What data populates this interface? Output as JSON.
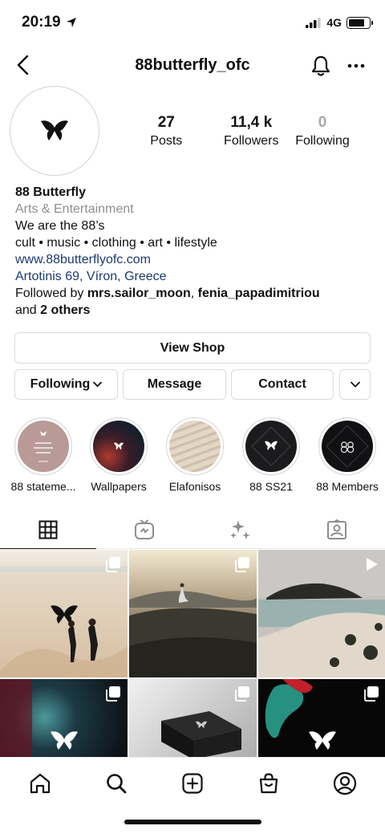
{
  "status_bar": {
    "time": "20:19",
    "network": "4G",
    "battery_level": 0.8
  },
  "nav": {
    "username": "88butterfly_ofc",
    "back_icon": "chevron-left-icon",
    "bell_icon": "bell-icon",
    "more_icon": "more-horizontal-icon"
  },
  "stats": [
    {
      "value": "27",
      "label": "Posts"
    },
    {
      "value": "11,4 k",
      "label": "Followers"
    },
    {
      "value": "0",
      "label": "Following"
    }
  ],
  "bio": {
    "name": "88 Butterfly",
    "category": "Arts & Entertainment",
    "line1": "We are the 88’s",
    "line2": "cult • music • clothing • art • lifestyle",
    "website": "www.88butterflyofc.com",
    "address": "Artotinis 69, Víron, Greece",
    "followed_by_prefix": "Followed by ",
    "followed_user1": "mrs.sailor_moon",
    "followed_sep": ", ",
    "followed_user2": "fenia_papadimitriou",
    "followed_and": "and ",
    "followed_others": "2 others"
  },
  "buttons": {
    "view_shop": "View Shop",
    "following": "Following",
    "message": "Message",
    "contact": "Contact"
  },
  "highlights": [
    {
      "label": "88 stateme...",
      "bg": "#b99a97"
    },
    {
      "label": "Wallpapers",
      "bg": "#1d2733"
    },
    {
      "label": "Elafonisos",
      "bg": "#d8cbb9"
    },
    {
      "label": "88 SS21",
      "bg": "#1b1b1e"
    },
    {
      "label": "88 Members",
      "bg": "#111114"
    }
  ],
  "tabs": [
    "grid-icon",
    "igtv-icon",
    "reels-sparkle-icon",
    "tagged-icon"
  ],
  "bottom_nav": [
    "home-icon",
    "search-icon",
    "new-post-icon",
    "shop-bag-icon",
    "profile-icon"
  ],
  "colors": {
    "link": "#1b3a70",
    "muted": "#8e8e8e",
    "border": "#dbdbdb"
  }
}
